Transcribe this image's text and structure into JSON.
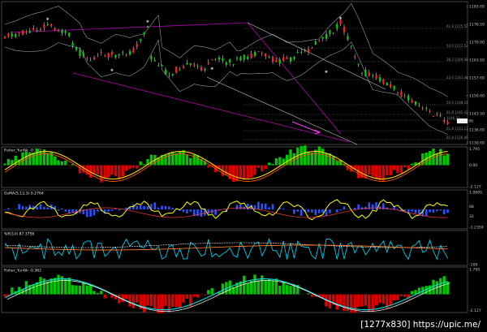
{
  "watermark": "[1277x830] https://upic.me/",
  "main_chart": {
    "price_labels": [
      "1183.00",
      "1176.50",
      "1170.00",
      "1163.50",
      "1157.00",
      "1150.00",
      "1143.50",
      "1136.00",
      "1130.00"
    ],
    "fib_labels": [
      "61.8 1175.52",
      "50.0 1172.52",
      "38.2 1169.50",
      "23.6 1161.48",
      "50.0 1148.31",
      "61.8 1145.43",
      "1146.23",
      "61.8 1131.17",
      "61.8 1126.46"
    ],
    "current_price": "1141.96"
  },
  "indicators": [
    {
      "title": "Fisher_Yur4ik -0.362",
      "axis_labels": [
        "1.795",
        "0.00",
        "-2.127"
      ],
      "colors": {
        "up": "#00c800",
        "down": "#e00000",
        "line": "#ffd700",
        "fast": "#ff5000"
      }
    },
    {
      "title": "OsMA(5,12,3) 0.2764",
      "axis_labels": [
        "1.0905",
        "68",
        "32",
        "-1.2359"
      ],
      "colors": {
        "bars": "#2a52ff",
        "line": "#ffff00",
        "signal": "#ff3c3c"
      }
    },
    {
      "title": "%R(14) 87.3756",
      "axis_labels": [
        "-100"
      ],
      "colors": {
        "line": "#00c8e8",
        "ma1": "#ffffff",
        "ma2": "#ff7a2a"
      }
    },
    {
      "title": "Fisher_Yur4ik -0.362",
      "axis_labels": [
        "1.795",
        "-2.127"
      ],
      "colors": {
        "up": "#00c800",
        "down": "#e00000",
        "line": "#00e0e0",
        "line2": "#ffffff"
      }
    }
  ],
  "colors": {
    "background": "#000000",
    "bull": "#00d000",
    "bear": "#ff2020",
    "wick": "#ffffff",
    "band": "#8fa0a8",
    "channel": "#b400b4",
    "arrow": "#ff40ff",
    "trend": "#c8c8c8"
  }
}
